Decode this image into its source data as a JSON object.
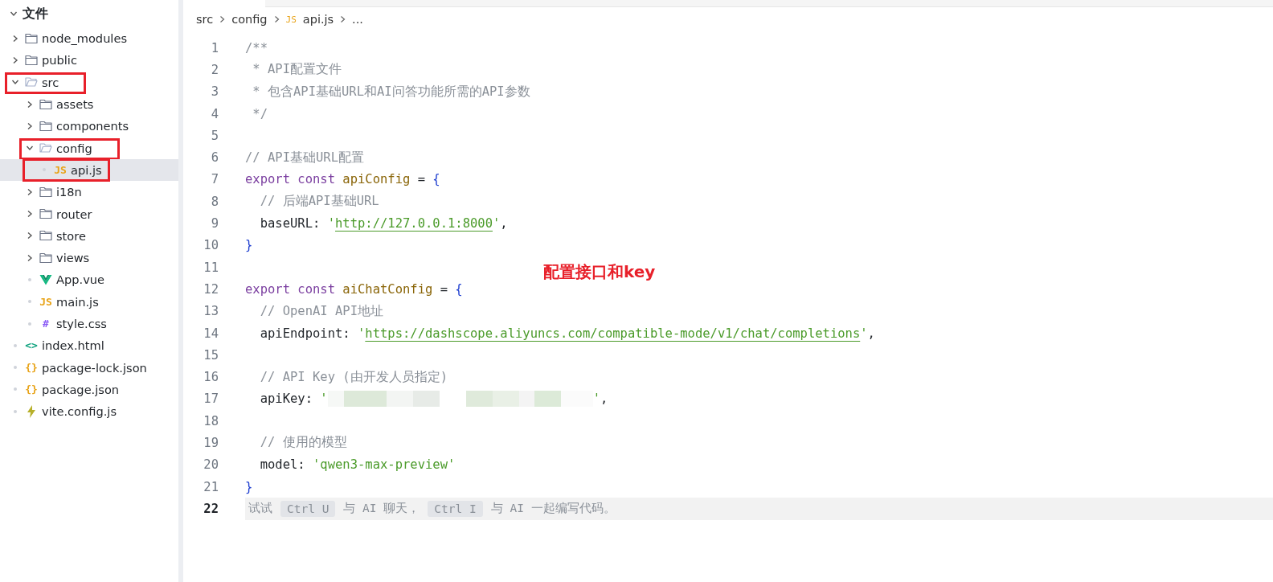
{
  "sidebar": {
    "title": "文件",
    "expanded": true,
    "items": [
      {
        "label": "node_modules",
        "kind": "folder",
        "expanded": false,
        "selected": false,
        "annotated": false
      },
      {
        "label": "public",
        "kind": "folder",
        "expanded": false,
        "selected": false,
        "annotated": false
      },
      {
        "label": "src",
        "kind": "folder",
        "expanded": true,
        "selected": false,
        "annotated": true,
        "children": [
          {
            "label": "assets",
            "kind": "folder",
            "expanded": false,
            "selected": false,
            "annotated": false
          },
          {
            "label": "components",
            "kind": "folder",
            "expanded": false,
            "selected": false,
            "annotated": false
          },
          {
            "label": "config",
            "kind": "folder",
            "expanded": true,
            "selected": false,
            "annotated": true,
            "children": [
              {
                "label": "api.js",
                "kind": "badge",
                "icon_text": "JS",
                "color": "#e8a317",
                "selected": true,
                "annotated": true
              }
            ]
          },
          {
            "label": "i18n",
            "kind": "folder",
            "expanded": false,
            "selected": false,
            "annotated": false
          },
          {
            "label": "router",
            "kind": "folder",
            "expanded": false,
            "selected": false,
            "annotated": false
          },
          {
            "label": "store",
            "kind": "folder",
            "expanded": false,
            "selected": false,
            "annotated": false
          },
          {
            "label": "views",
            "kind": "folder",
            "expanded": false,
            "selected": false,
            "annotated": false
          },
          {
            "label": "App.vue",
            "kind": "vue",
            "selected": false,
            "annotated": false
          },
          {
            "label": "main.js",
            "kind": "badge",
            "icon_text": "JS",
            "color": "#e8a317",
            "selected": false,
            "annotated": false
          },
          {
            "label": "style.css",
            "kind": "badge",
            "icon_text": "#",
            "color": "#8b5cf6",
            "selected": false,
            "annotated": false
          }
        ]
      },
      {
        "label": "index.html",
        "kind": "badge",
        "icon_text": "<>",
        "color": "#10a37f",
        "selected": false,
        "annotated": false
      },
      {
        "label": "package-lock.json",
        "kind": "badge",
        "icon_text": "{}",
        "color": "#e8a317",
        "selected": false,
        "annotated": false
      },
      {
        "label": "package.json",
        "kind": "badge",
        "icon_text": "{}",
        "color": "#e8a317",
        "selected": false,
        "annotated": false
      },
      {
        "label": "vite.config.js",
        "kind": "vite",
        "selected": false,
        "annotated": false
      }
    ]
  },
  "breadcrumb": [
    {
      "label": "src"
    },
    {
      "label": "config"
    },
    {
      "label": "api.js",
      "icon_text": "JS"
    },
    {
      "label": "..."
    }
  ],
  "editor": {
    "annotation": "配置接口和key",
    "lines": [
      {
        "number": "1",
        "kind": "code",
        "tokens": [
          {
            "kind": "comment",
            "text": "/**"
          }
        ]
      },
      {
        "number": "2",
        "kind": "code",
        "tokens": [
          {
            "kind": "comment",
            "text": " * API配置文件"
          }
        ]
      },
      {
        "number": "3",
        "kind": "code",
        "tokens": [
          {
            "kind": "comment",
            "text": " * 包含API基础URL和AI问答功能所需的API参数"
          }
        ]
      },
      {
        "number": "4",
        "kind": "code",
        "tokens": [
          {
            "kind": "comment",
            "text": " */"
          }
        ]
      },
      {
        "number": "5",
        "kind": "code"
      },
      {
        "number": "6",
        "kind": "code",
        "tokens": [
          {
            "kind": "comment",
            "text": "// API基础URL配置"
          }
        ]
      },
      {
        "number": "7",
        "kind": "code",
        "tokens": [
          {
            "kind": "keyword",
            "text": "export const "
          },
          {
            "kind": "name",
            "text": "apiConfig"
          },
          {
            "kind": "plain",
            "text": " = "
          },
          {
            "kind": "brace",
            "text": "{"
          }
        ]
      },
      {
        "number": "8",
        "kind": "code",
        "tokens": [
          {
            "kind": "comment",
            "text": "  // 后端API基础URL"
          }
        ]
      },
      {
        "number": "9",
        "kind": "code",
        "tokens": [
          {
            "kind": "plain",
            "text": "  baseURL: "
          },
          {
            "kind": "string",
            "text": "'"
          },
          {
            "kind": "url",
            "text": "http://127.0.0.1:8000"
          },
          {
            "kind": "string",
            "text": "'"
          },
          {
            "kind": "plain",
            "text": ","
          }
        ]
      },
      {
        "number": "10",
        "kind": "code",
        "tokens": [
          {
            "kind": "brace",
            "text": "}"
          }
        ]
      },
      {
        "number": "11",
        "kind": "code"
      },
      {
        "number": "12",
        "kind": "code",
        "tokens": [
          {
            "kind": "keyword",
            "text": "export const "
          },
          {
            "kind": "name",
            "text": "aiChatConfig"
          },
          {
            "kind": "plain",
            "text": " = "
          },
          {
            "kind": "brace",
            "text": "{"
          }
        ]
      },
      {
        "number": "13",
        "kind": "code",
        "tokens": [
          {
            "kind": "comment",
            "text": "  // OpenAI API地址"
          }
        ]
      },
      {
        "number": "14",
        "kind": "code",
        "tokens": [
          {
            "kind": "plain",
            "text": "  apiEndpoint: "
          },
          {
            "kind": "string",
            "text": "'"
          },
          {
            "kind": "url",
            "text": "https://dashscope.aliyuncs.com/compatible-mode/v1/chat/completions"
          },
          {
            "kind": "string",
            "text": "'"
          },
          {
            "kind": "plain",
            "text": ","
          }
        ]
      },
      {
        "number": "15",
        "kind": "code"
      },
      {
        "number": "16",
        "kind": "code",
        "tokens": [
          {
            "kind": "comment",
            "text": "  // API Key (由开发人员指定)"
          }
        ]
      },
      {
        "number": "17",
        "kind": "code",
        "tokens": [
          {
            "kind": "plain",
            "text": "  apiKey: "
          },
          {
            "kind": "string",
            "text": "'"
          },
          {
            "kind": "redacted"
          },
          {
            "kind": "string",
            "text": "'"
          },
          {
            "kind": "plain",
            "text": ","
          }
        ]
      },
      {
        "number": "18",
        "kind": "code"
      },
      {
        "number": "19",
        "kind": "code",
        "tokens": [
          {
            "kind": "comment",
            "text": "  // 使用的模型"
          }
        ]
      },
      {
        "number": "20",
        "kind": "code",
        "tokens": [
          {
            "kind": "plain",
            "text": "  model: "
          },
          {
            "kind": "string",
            "text": "'qwen3-max-preview'"
          }
        ]
      },
      {
        "number": "21",
        "kind": "code",
        "tokens": [
          {
            "kind": "brace",
            "text": "}"
          }
        ]
      },
      {
        "number": "22",
        "kind": "hint",
        "current": true,
        "tokens": [
          {
            "kind": "text",
            "text": "试试"
          },
          {
            "kind": "key",
            "text": "Ctrl U"
          },
          {
            "kind": "text",
            "text": "与 AI 聊天，"
          },
          {
            "kind": "key",
            "text": "Ctrl I"
          },
          {
            "kind": "text",
            "text": "与 AI 一起编写代码。"
          }
        ]
      }
    ]
  }
}
